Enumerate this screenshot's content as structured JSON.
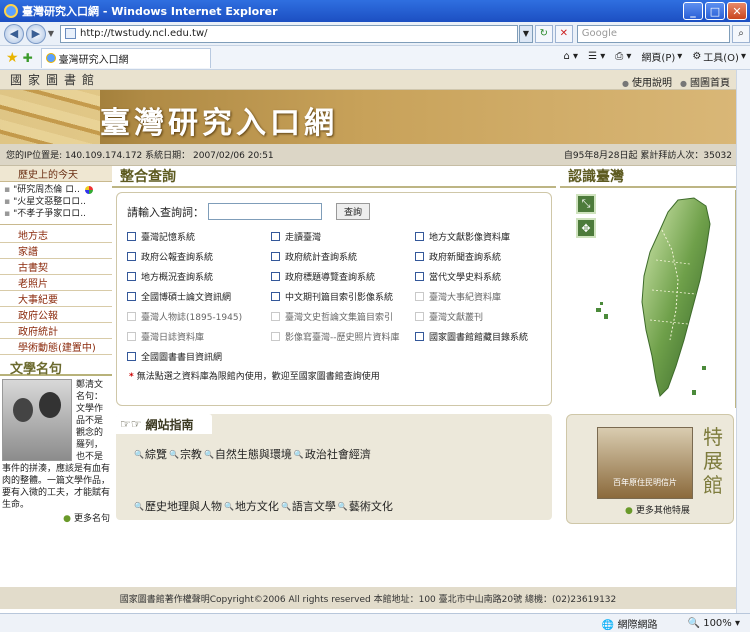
{
  "window": {
    "title": "臺灣研究入口網 - Windows Internet Explorer",
    "minimize": "_",
    "maximize": "□",
    "close": "✕"
  },
  "browser": {
    "url": "http://twstudy.ncl.edu.tw/",
    "search_placeholder": "Google",
    "tab_title": "臺灣研究入口網",
    "commands": {
      "page": "網頁(P)",
      "tools": "工具(O)"
    }
  },
  "site": {
    "org": "國家圖書館",
    "top_links": [
      "使用說明",
      "國圖首頁"
    ],
    "title": "臺灣研究入口網",
    "ip_info": "您的IP位置是: 140.109.174.172  系統日期： 2007/02/06 20:51",
    "visitor_count": "自95年8月28日起 累計拜訪人次：35032"
  },
  "left": {
    "today_title": "歷史上的今天",
    "today_items": [
      "\"研究周杰倫 ロ..",
      "\"火星文惡整ロロ..",
      "\"不孝子爭家ロロ.."
    ],
    "categories": [
      "地方志",
      "家譜",
      "古書契",
      "老照片",
      "大事紀要",
      "政府公報",
      "政府統計",
      "學術動態(建置中)"
    ],
    "quote_title": "文學名句",
    "quote_author": "鄭清文名句：",
    "quote_text": "文學作品不是觀念的羅列，也不是事件的拼湊，應該是有血有肉的整體。一篇文學作品，要有入微的工夫，才能賦有生命。",
    "more": "更多名句"
  },
  "search": {
    "title": "整合查詢",
    "prompt": "請輸入查詢詞：",
    "input_value": "",
    "button": "查詢",
    "options": [
      {
        "label": "臺灣記憶系統",
        "enabled": true
      },
      {
        "label": "走讀臺灣",
        "enabled": true
      },
      {
        "label": "地方文獻影像資料庫",
        "enabled": true
      },
      {
        "label": "政府公報查詢系統",
        "enabled": true
      },
      {
        "label": "政府統計查詢系統",
        "enabled": true
      },
      {
        "label": "政府新聞查詢系統",
        "enabled": true
      },
      {
        "label": "地方概況查詢系統",
        "enabled": true
      },
      {
        "label": "政府標題導覽查詢系統",
        "enabled": true
      },
      {
        "label": "當代文學史料系統",
        "enabled": true
      },
      {
        "label": "全國博碩士論文資訊網",
        "enabled": true
      },
      {
        "label": "中文期刊篇目索引影像系統",
        "enabled": true
      },
      {
        "label": "臺灣大事紀資料庫",
        "enabled": false
      },
      {
        "label": "臺灣人物誌(1895-1945)",
        "enabled": false
      },
      {
        "label": "臺灣文史哲論文集篇目索引",
        "enabled": false
      },
      {
        "label": "臺灣文獻叢刊",
        "enabled": false
      },
      {
        "label": "臺灣日誌資料庫",
        "enabled": false
      },
      {
        "label": "影像寫臺灣--歷史照片資料庫",
        "enabled": false
      },
      {
        "label": "國家圖書館館藏目錄系統",
        "enabled": true
      },
      {
        "label": "全國圖書書目資訊網",
        "enabled": true
      }
    ],
    "note_mark": "*",
    "note": "無法點選之資料庫為限館內使用，歡迎至國家圖書館查詢使用"
  },
  "guide": {
    "title": "網站指南",
    "links": [
      "綜覽",
      "宗教",
      "自然生態與環境",
      "政治社會經濟",
      "歷史地理與人物",
      "地方文化",
      "語言文學",
      "藝術文化"
    ]
  },
  "right": {
    "title": "認識臺灣",
    "special_title": "特展館",
    "special_caption": "百年原住民明信片",
    "more": "更多其他特展"
  },
  "footer": "國家圖書館著作權聲明Copyright©2006 All rights reserved   本館地址：100 臺北市中山南路20號   總機：(02)23619132",
  "status": {
    "zone": "網際網路",
    "zoom": "100%"
  },
  "colors": {
    "title_bar": "#1c4fc2",
    "accent_olive": "#5d5a20",
    "category_text": "#8b2a0c"
  }
}
